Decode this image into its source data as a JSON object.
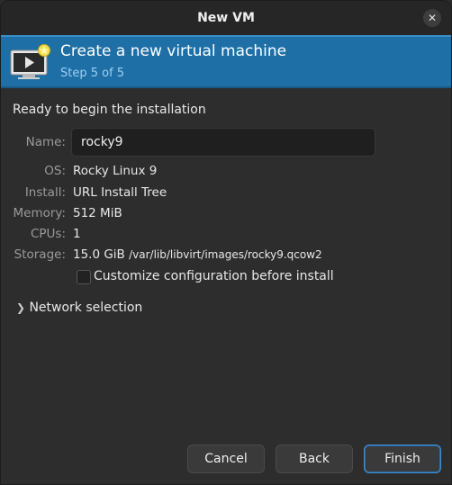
{
  "window": {
    "title": "New VM",
    "close_icon": "close-icon"
  },
  "banner": {
    "title": "Create a new virtual machine",
    "step": "Step 5 of 5",
    "icon": "virtual-machine-icon",
    "color": "#1e6fa6"
  },
  "summary": {
    "heading": "Ready to begin the installation",
    "name_label": "Name:",
    "name_value": "rocky9",
    "os_label": "OS:",
    "os_value": "Rocky Linux 9",
    "install_label": "Install:",
    "install_value": "URL Install Tree",
    "memory_label": "Memory:",
    "memory_value": "512 MiB",
    "cpus_label": "CPUs:",
    "cpus_value": "1",
    "storage_label": "Storage:",
    "storage_size": "15.0 GiB",
    "storage_path": "/var/lib/libvirt/images/rocky9.qcow2"
  },
  "customize": {
    "label": "Customize configuration before install",
    "checked": false
  },
  "network": {
    "label": "Network selection",
    "expanded": false
  },
  "buttons": {
    "cancel": "Cancel",
    "back": "Back",
    "finish": "Finish",
    "accent": "#3f8fd1"
  }
}
